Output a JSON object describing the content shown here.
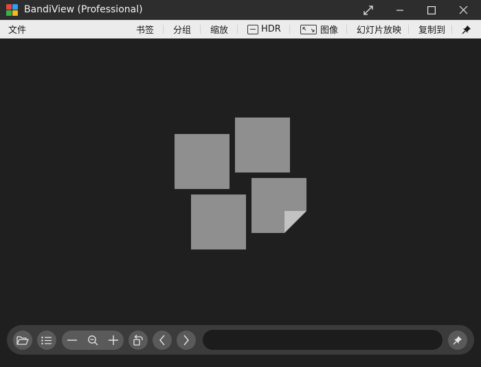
{
  "window": {
    "title": "BandiView (Professional)",
    "logo_colors": [
      "#e8453c",
      "#2ea0f0",
      "#38b24a",
      "#f6b81d"
    ]
  },
  "menubar": {
    "file": "文件",
    "bookmarks": "书签",
    "group": "分组",
    "zoom": "缩放",
    "hdr": "HDR",
    "image": "图像",
    "slideshow": "幻灯片放映",
    "copy_to": "复制到"
  },
  "canvas": {
    "state": "no image loaded",
    "placeholder_color": "#8f8f8f"
  },
  "toolbar": {
    "path_value": "",
    "icons": [
      "folder-open-icon",
      "list-icon",
      "minus-icon",
      "zoom-icon",
      "plus-icon",
      "rotate-icon",
      "prev-icon",
      "next-icon",
      "pin-icon"
    ]
  }
}
